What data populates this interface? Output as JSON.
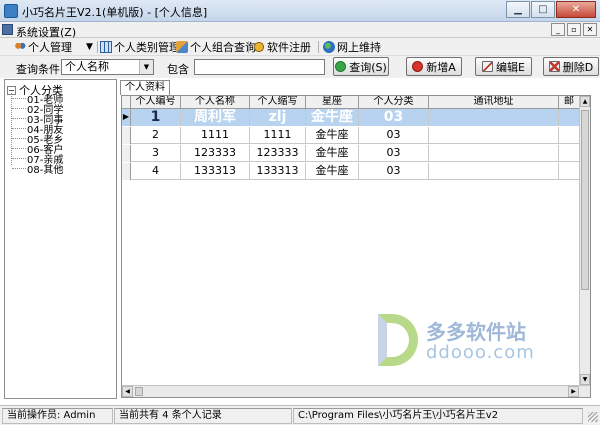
{
  "window": {
    "title": "小巧名片王V2.1(单机版) - [个人信息]"
  },
  "menubar": {
    "system_menu": "系统设置(Z)"
  },
  "toolbar": {
    "items": [
      {
        "label": "个人管理",
        "icon": "people-icon"
      },
      {
        "label": "个人类别管理",
        "icon": "category-grid-icon"
      },
      {
        "label": "个人组合查询",
        "icon": "combined-search-icon"
      },
      {
        "label": "软件注册",
        "icon": "register-key-icon"
      },
      {
        "label": "网上维持",
        "icon": "globe-icon"
      }
    ]
  },
  "query": {
    "condition_label": "查询条件",
    "condition_value": "个人名称",
    "contains_label": "包含",
    "search_value": "",
    "query_button": "查询(S)",
    "add_button": "新增A",
    "edit_button": "编辑E",
    "delete_button": "删除D"
  },
  "tree": {
    "root": "个人分类",
    "items": [
      "01-老师",
      "02-同学",
      "03-同事",
      "04-朋友",
      "05-老乡",
      "06-客户",
      "07-亲戚",
      "08-其他"
    ]
  },
  "tab": {
    "label": "个人资料"
  },
  "grid": {
    "columns": [
      "个人编号",
      "个人名称",
      "个人缩写",
      "星座",
      "个人分类",
      "通讯地址",
      "邮"
    ],
    "rows": [
      [
        "1",
        "周利军",
        "zlj",
        "金牛座",
        "03",
        "",
        ""
      ],
      [
        "2",
        "1111",
        "1111",
        "金牛座",
        "03",
        "",
        ""
      ],
      [
        "3",
        "123333",
        "123333",
        "金牛座",
        "03",
        "",
        ""
      ],
      [
        "4",
        "133313",
        "133313",
        "金牛座",
        "03",
        "",
        ""
      ]
    ],
    "selected_row": 0
  },
  "watermark": {
    "line1": "多多软件站",
    "line2": "ddooo.com"
  },
  "status": {
    "operator": "当前操作员: Admin",
    "count": "当前共有 4 条个人记录",
    "path": "C:\\Program Files\\小巧名片王\\小巧名片王v2"
  },
  "colors": {
    "selection": "#b7d3f0",
    "accent": "#3d7fc4"
  }
}
